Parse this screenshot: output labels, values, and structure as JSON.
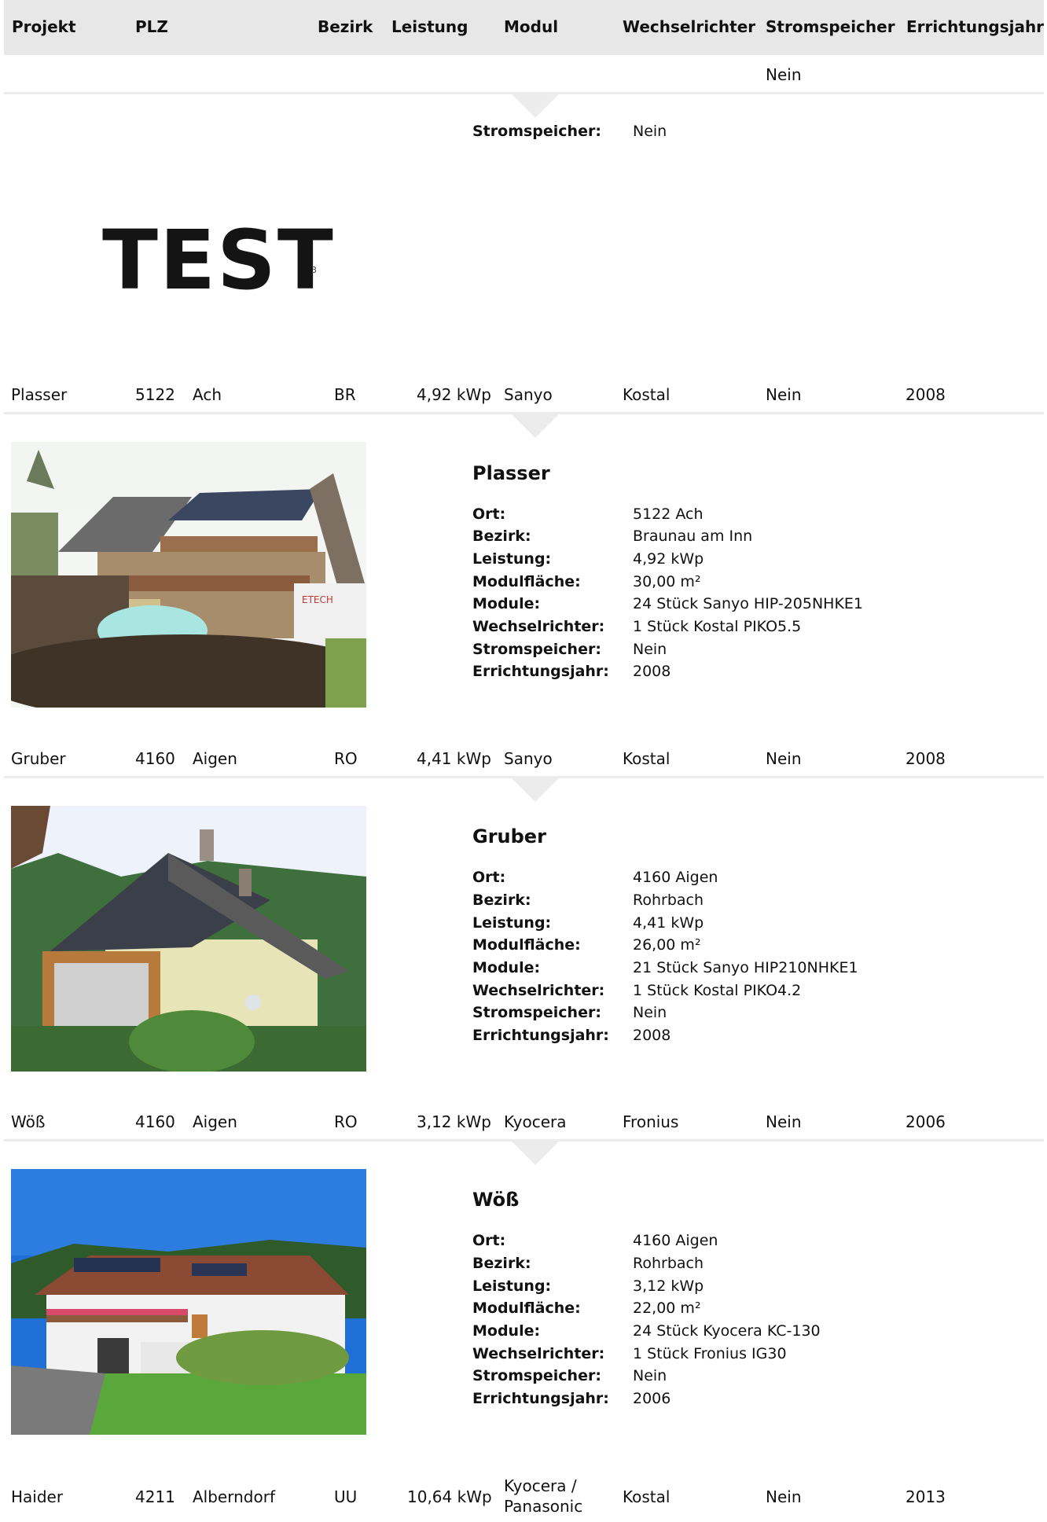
{
  "header": {
    "projekt": "Projekt",
    "plz": "PLZ",
    "bezirk": "Bezirk",
    "leistung": "Leistung",
    "modul": "Modul",
    "wechselrichter": "Wechselrichter",
    "stromspeicher": "Stromspeicher",
    "errichtungsjahr": "Errichtungsjahr"
  },
  "row0": {
    "stromspeicher": "Nein"
  },
  "detail0": {
    "label_stromspeicher": "Stromspeicher:",
    "val_stromspeicher": "Nein",
    "logo_text": "TEST",
    "logo_small": "3"
  },
  "rows": [
    {
      "projekt": "Plasser",
      "plz": "5122",
      "ort": "Ach",
      "bezirk": "BR",
      "leistung": "4,92 kWp",
      "modul": "Sanyo",
      "wechselrichter": "Kostal",
      "stromspeicher": "Nein",
      "jahr": "2008"
    },
    {
      "projekt": "Gruber",
      "plz": "4160",
      "ort": "Aigen",
      "bezirk": "RO",
      "leistung": "4,41 kWp",
      "modul": "Sanyo",
      "wechselrichter": "Kostal",
      "stromspeicher": "Nein",
      "jahr": "2008"
    },
    {
      "projekt": "Wöß",
      "plz": "4160",
      "ort": "Aigen",
      "bezirk": "RO",
      "leistung": "3,12 kWp",
      "modul": "Kyocera",
      "wechselrichter": "Fronius",
      "stromspeicher": "Nein",
      "jahr": "2006"
    },
    {
      "projekt": "Haider",
      "plz": "4211",
      "ort": "Alberndorf",
      "bezirk": "UU",
      "leistung": "10,64 kWp",
      "modul_line1": "Kyocera /",
      "modul_line2": "Panasonic",
      "wechselrichter": "Kostal",
      "stromspeicher": "Nein",
      "jahr": "2013"
    }
  ],
  "labels": {
    "ort": "Ort:",
    "bezirk": "Bezirk:",
    "leistung": "Leistung:",
    "modulflaeche": "Modulfläche:",
    "module": "Module:",
    "wechselrichter": "Wechselrichter:",
    "stromspeicher": "Stromspeicher:",
    "errichtungsjahr": "Errichtungsjahr:"
  },
  "details": [
    {
      "title": "Plasser",
      "ort": "5122 Ach",
      "bezirk": "Braunau am Inn",
      "leistung": "4,92 kWp",
      "modulflaeche": "30,00 m²",
      "module": "24 Stück Sanyo HIP-205NHKE1",
      "wechselrichter": "1 Stück Kostal PIKO5.5",
      "stromspeicher": "Nein",
      "errichtungsjahr": "2008",
      "van_text": "ETECH"
    },
    {
      "title": "Gruber",
      "ort": "4160 Aigen",
      "bezirk": "Rohrbach",
      "leistung": "4,41 kWp",
      "modulflaeche": "26,00 m²",
      "module": "21 Stück Sanyo HIP210NHKE1",
      "wechselrichter": "1 Stück Kostal PIKO4.2",
      "stromspeicher": "Nein",
      "errichtungsjahr": "2008"
    },
    {
      "title": "Wöß",
      "ort": "4160 Aigen",
      "bezirk": "Rohrbach",
      "leistung": "3,12 kWp",
      "modulflaeche": "22,00 m²",
      "module": "24 Stück Kyocera KC-130",
      "wechselrichter": "1 Stück Fronius IG30",
      "stromspeicher": "Nein",
      "errichtungsjahr": "2006"
    }
  ]
}
